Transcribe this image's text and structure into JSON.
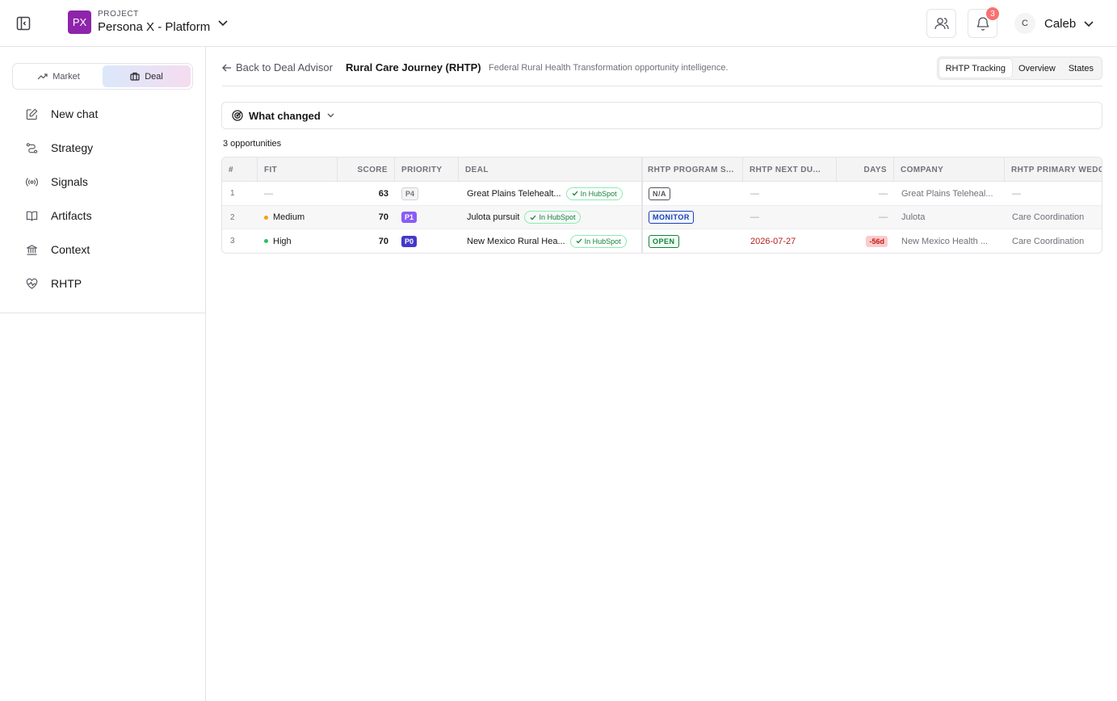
{
  "project": {
    "caption": "PROJECT",
    "initials": "PX",
    "name": "Persona X - Platform",
    "badge_color": "#8e24aa"
  },
  "topbar": {
    "notifications_count": "3",
    "user_initial": "C",
    "user_name": "Caleb"
  },
  "mode_switch": {
    "market_label": "Market",
    "deal_label": "Deal",
    "active": "Deal"
  },
  "nav": {
    "items": [
      {
        "label": "New chat",
        "icon": "edit-icon"
      },
      {
        "label": "Strategy",
        "icon": "strategy-icon"
      },
      {
        "label": "Signals",
        "icon": "signal-icon"
      },
      {
        "label": "Artifacts",
        "icon": "book-icon"
      },
      {
        "label": "Context",
        "icon": "landmark-icon"
      },
      {
        "label": "RHTP",
        "icon": "heart-pulse-icon"
      }
    ]
  },
  "header": {
    "back_label": "Back to Deal Advisor",
    "title": "Rural Care Journey (RHTP)",
    "subtitle": "Federal Rural Health Transformation opportunity intelligence.",
    "tabs": [
      "RHTP Tracking",
      "Overview",
      "States"
    ],
    "active_tab": "RHTP Tracking"
  },
  "what_changed": {
    "label": "What changed"
  },
  "table": {
    "count_label": "3 opportunities",
    "columns": [
      "#",
      "FIT",
      "SCORE",
      "PRIORITY",
      "DEAL",
      "RHTP PROGRAM S...",
      "RHTP NEXT DU...",
      "DAYS",
      "COMPANY",
      "RHTP PRIMARY WEDGE"
    ],
    "rows": [
      {
        "index": "1",
        "fit": "—",
        "fit_color": "",
        "score": "63",
        "priority": "P4",
        "priority_bg": "#f4f4f5",
        "priority_fg": "#71717a",
        "deal": "Great Plains Telehealt...",
        "hubspot": "In HubSpot",
        "status": "N/A",
        "status_color": "#52525b",
        "status_bg": "#ffffff",
        "next_due": "—",
        "next_due_color": "#a1a1aa",
        "days": "—",
        "company": "Great Plains Teleheal...",
        "wedge": "—"
      },
      {
        "index": "2",
        "fit": "Medium",
        "fit_color": "#f59e0b",
        "score": "70",
        "priority": "P1",
        "priority_bg": "#8b5cf6",
        "priority_fg": "#ffffff",
        "deal": "Julota pursuit",
        "hubspot": "In HubSpot",
        "status": "MONITOR",
        "status_color": "#1e40af",
        "status_bg": "#eff6ff",
        "next_due": "—",
        "next_due_color": "#a1a1aa",
        "days": "—",
        "company": "Julota",
        "wedge": "Care Coordination"
      },
      {
        "index": "3",
        "fit": "High",
        "fit_color": "#22c55e",
        "score": "70",
        "priority": "P0",
        "priority_bg": "#4338ca",
        "priority_fg": "#ffffff",
        "deal": "New Mexico Rural Hea...",
        "hubspot": "In HubSpot",
        "status": "OPEN",
        "status_color": "#15803d",
        "status_bg": "#f0fdf4",
        "next_due": "2026-07-27",
        "next_due_color": "#b91c1c",
        "days": "-56d",
        "company": "New Mexico Health ...",
        "wedge": "Care Coordination"
      }
    ]
  }
}
